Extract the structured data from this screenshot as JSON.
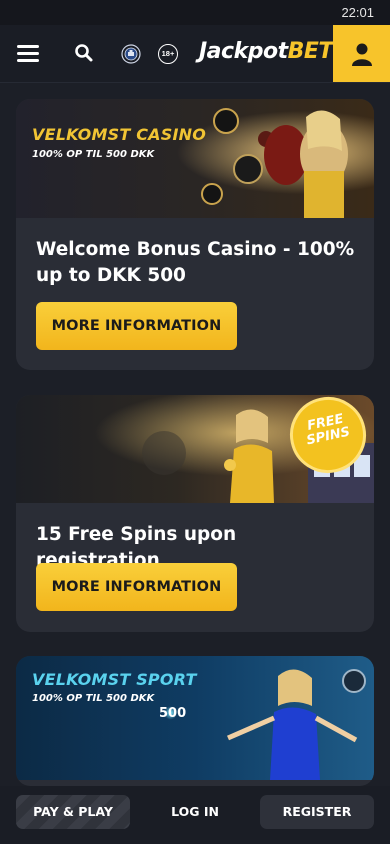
{
  "status_bar": {
    "time": "22:01"
  },
  "header": {
    "logo_part1": "Jackpot",
    "logo_part2": "BET",
    "age_badge": "18+",
    "icons": [
      "menu-icon",
      "search-icon",
      "license-seal-icon",
      "age-18-icon",
      "user-icon"
    ]
  },
  "cards": [
    {
      "banner_title": "VELKOMST CASINO",
      "banner_sub": "100% OP TIL 500 DKK",
      "title": "Welcome Bonus Casino - 100% up to DKK 500",
      "button": "MORE INFORMATION"
    },
    {
      "badge_line1": "FREE",
      "badge_line2": "SPINS",
      "title": "15 Free Spins upon registration",
      "button": "MORE INFORMATION"
    },
    {
      "banner_title": "VELKOMST SPORT",
      "banner_sub": "100% OP TIL 500 DKK",
      "bonus_amount": "500"
    }
  ],
  "bottom_bar": {
    "pay_play": "PAY & PLAY",
    "login": "LOG IN",
    "register": "REGISTER"
  },
  "colors": {
    "accent": "#f7c42b",
    "background": "#1c1f27",
    "card": "#2a2d36",
    "sport_title": "#5ad2ee"
  }
}
